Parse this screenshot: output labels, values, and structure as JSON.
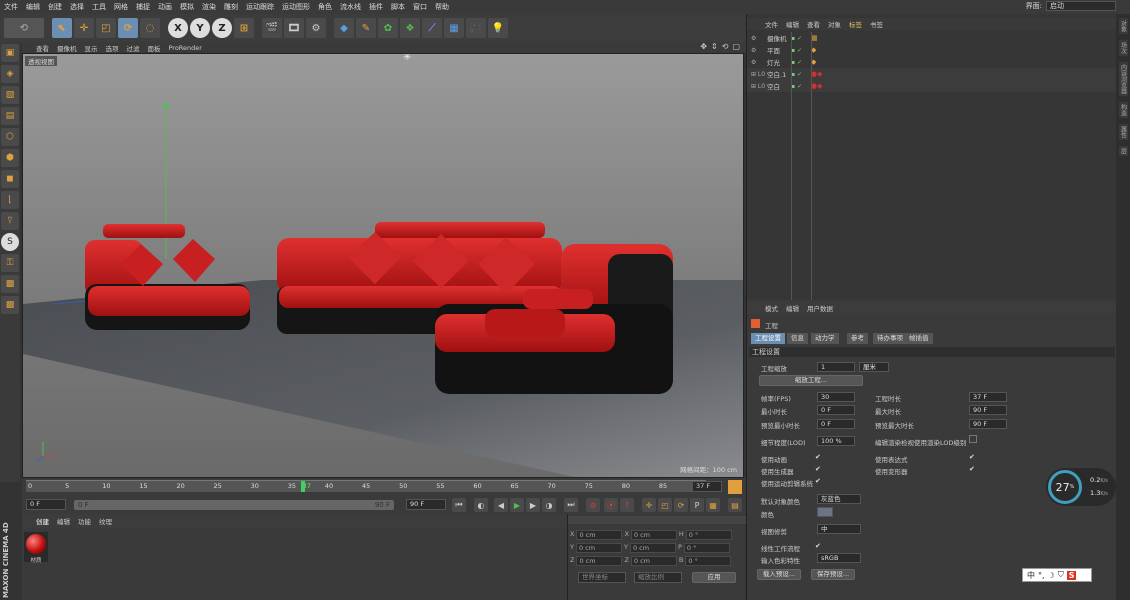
{
  "menubar": {
    "items": [
      "文件",
      "编辑",
      "创建",
      "选择",
      "工具",
      "网格",
      "捕捉",
      "动画",
      "模拟",
      "渲染",
      "雕刻",
      "运动跟踪",
      "运动图形",
      "角色",
      "流水线",
      "插件",
      "脚本",
      "窗口",
      "帮助"
    ],
    "layout_label": "界面:",
    "layout_value": "启动"
  },
  "toolbar": {
    "icons": [
      "undo-icon",
      "select-icon",
      "move-icon",
      "scale-icon",
      "rotate-icon",
      "x-axis-icon",
      "y-axis-icon",
      "z-axis-icon",
      "coord-icon",
      "render-view-icon",
      "render-icon",
      "render-settings-icon",
      "cube-icon",
      "pen-icon",
      "subdivide-icon",
      "array-icon",
      "deformer-icon",
      "floor-icon",
      "camera-icon",
      "light-icon"
    ],
    "axis_x": "X",
    "axis_y": "Y",
    "axis_z": "Z"
  },
  "viewport": {
    "menu": [
      "查看",
      "摄像机",
      "显示",
      "选项",
      "过滤",
      "面板",
      "ProRender"
    ],
    "label": "透视视图",
    "grid_info": "网格间距：100 cm"
  },
  "timeline": {
    "ticks": [
      "0",
      "5",
      "10",
      "15",
      "20",
      "25",
      "30",
      "35",
      "37",
      "40",
      "45",
      "50",
      "55",
      "60",
      "65",
      "70",
      "75",
      "80",
      "85",
      "90"
    ],
    "current_frame": 37,
    "frame_field": "37 F"
  },
  "transport": {
    "start": "0 F",
    "slider_start": "0 F",
    "slider_end": "90 F",
    "end": "90 F"
  },
  "material": {
    "menu": [
      "创建",
      "编辑",
      "功能",
      "纹理"
    ],
    "item_name": "材质"
  },
  "coords": {
    "rows": [
      {
        "a": "X",
        "av": "0 cm",
        "b": "X",
        "bv": "0 cm",
        "c": "H",
        "cv": "0 °"
      },
      {
        "a": "Y",
        "av": "0 cm",
        "b": "Y",
        "bv": "0 cm",
        "c": "P",
        "cv": "0 °"
      },
      {
        "a": "Z",
        "av": "0 cm",
        "b": "Z",
        "bv": "0 cm",
        "c": "B",
        "cv": "0 °"
      }
    ],
    "sel1": "世界坐标",
    "sel2": "缩放比例",
    "apply": "应用"
  },
  "objects": {
    "menu": [
      "文件",
      "编辑",
      "查看",
      "对象",
      "标签",
      "书签"
    ],
    "rows": [
      {
        "name": "摄像机",
        "color": "#bbb"
      },
      {
        "name": "平面",
        "color": "#bbb"
      },
      {
        "name": "灯光",
        "color": "#bbb"
      },
      {
        "name": "空白.1",
        "color": "#bbb"
      },
      {
        "name": "空白",
        "color": "#bbb"
      }
    ]
  },
  "attributes": {
    "menu": [
      "模式",
      "编辑",
      "用户数据"
    ],
    "title": "工程",
    "tabs": [
      "工程设置",
      "信息",
      "动力学",
      "参考",
      "待办事项",
      "帧插值"
    ],
    "section": "工程设置",
    "scale_label": "工程缩放",
    "scale_value": "1",
    "scale_unit": "厘米",
    "scale_button": "缩放工程...",
    "fps_label": "帧率(FPS)",
    "fps_value": "30",
    "length_label": "工程时长",
    "length_value": "37 F",
    "min_label": "最小时长",
    "min_value": "0 F",
    "max_label": "最大时长",
    "max_value": "90 F",
    "pmin_label": "预览最小时长",
    "pmin_value": "0 F",
    "pmax_label": "预览最大时长",
    "pmax_value": "90 F",
    "lod_label": "细节程度(LOD)",
    "lod_value": "100 %",
    "lod_render_label": "编辑渲染检视使用渲染LOD级别",
    "use_anim": "使用动画",
    "use_expr": "使用表达式",
    "use_gen": "使用生成器",
    "use_deform": "使用变形器",
    "use_motion": "使用运动剪辑系统",
    "default_color_label": "默认对象颜色",
    "default_color_value": "灰蓝色",
    "color_label": "颜色",
    "view_clip_label": "视图修剪",
    "view_clip_value": "中",
    "linear_label": "线性工作流程",
    "input_color_label": "输入色彩特性",
    "input_color_value": "sRGB",
    "load_preset": "载入预设...",
    "save_preset": "保存预设..."
  },
  "network": {
    "percent": "27",
    "unit": "%",
    "up": "0.2",
    "up_unit": "K/s",
    "down": "1.3",
    "down_unit": "K/s"
  },
  "ime": {
    "label": "中"
  },
  "side_tabs": [
    "对象",
    "场次",
    "内容浏览器",
    "构造",
    "属性",
    "层"
  ],
  "logo": "MAXON CINEMA 4D"
}
